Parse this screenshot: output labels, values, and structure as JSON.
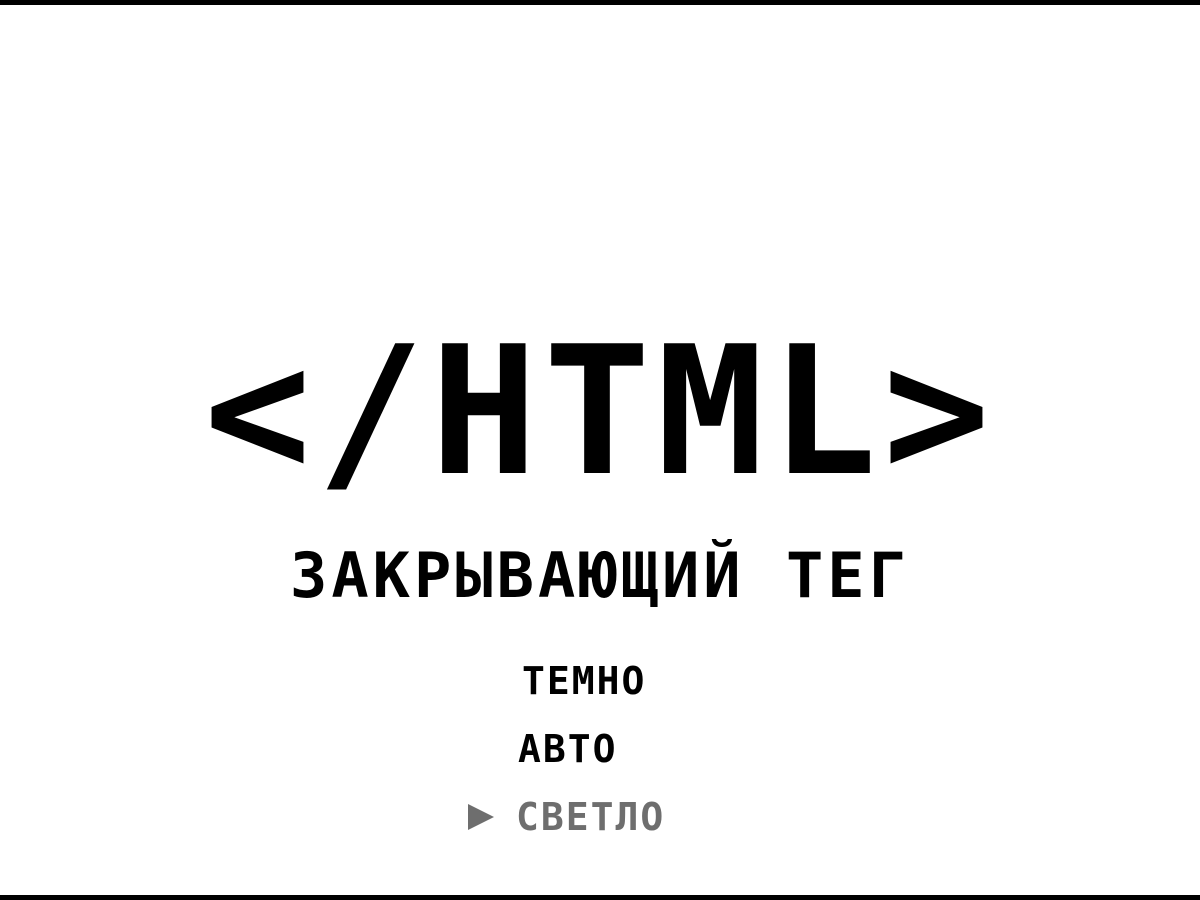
{
  "title": "</HTML>",
  "subtitle": "ЗАКРЫВАЮЩИЙ ТЕГ",
  "menu": {
    "items": [
      {
        "label": "ТЕМНО",
        "selected": false
      },
      {
        "label": "АВТО",
        "selected": false
      },
      {
        "label": "СВЕТЛО",
        "selected": true
      }
    ],
    "cursor_icon": "triangle-right-icon"
  },
  "colors": {
    "background": "#ffffff",
    "text": "#000000",
    "selected": "#6e6e6e"
  }
}
